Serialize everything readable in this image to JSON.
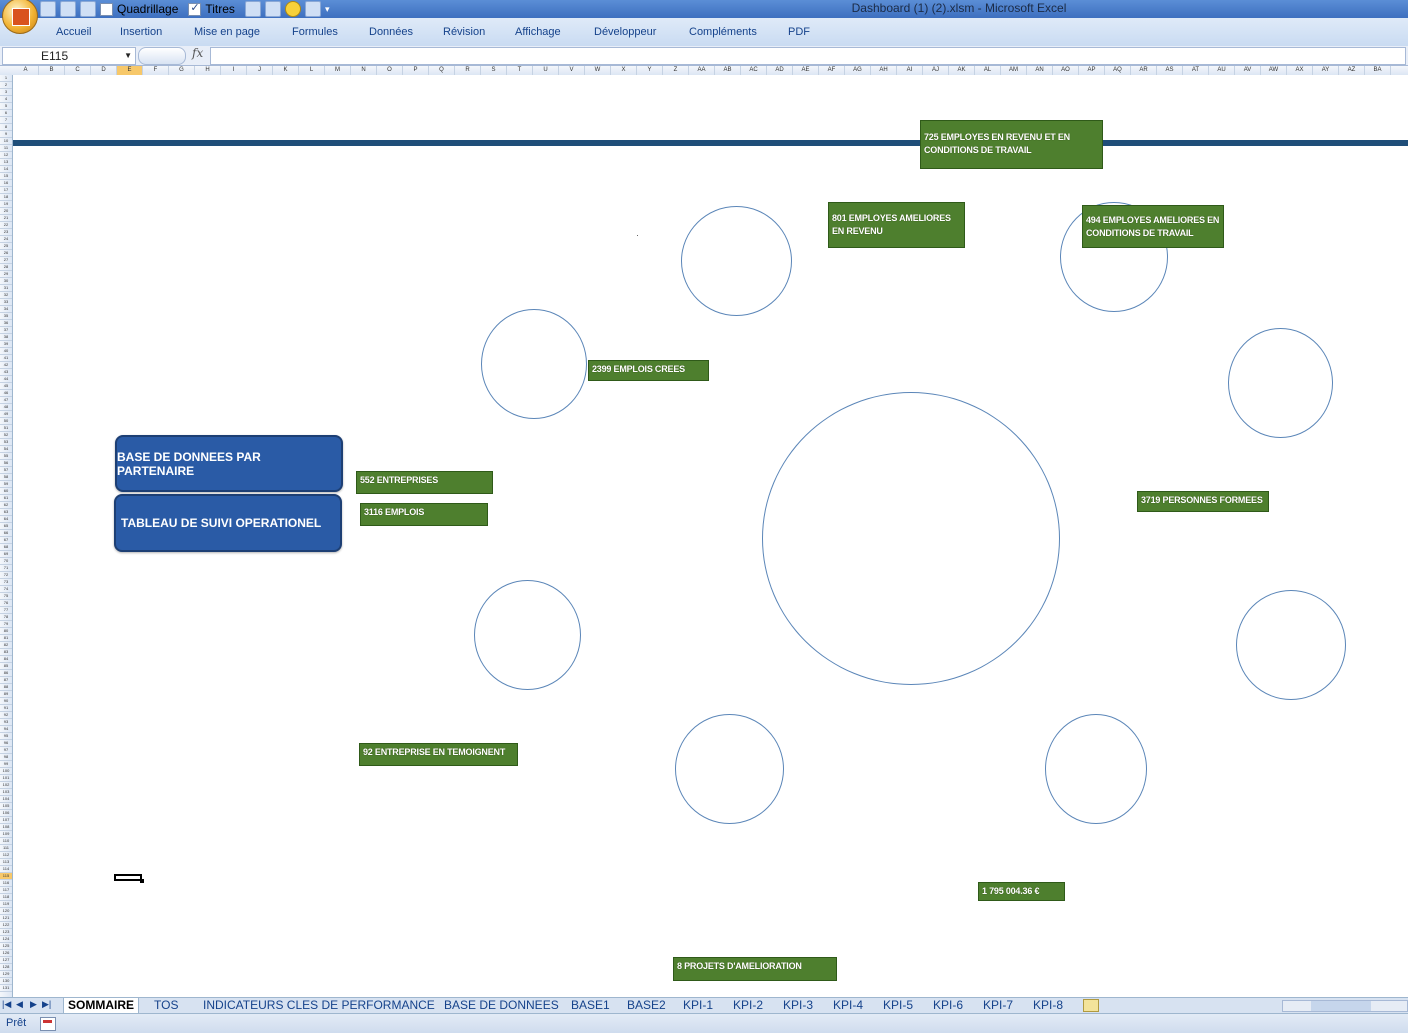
{
  "window": {
    "title": "Dashboard (1) (2).xlsm - Microsoft Excel"
  },
  "quick_access": {
    "gridlines_label": "Quadrillage",
    "gridlines_checked": false,
    "headings_label": "Titres",
    "headings_checked": true
  },
  "ribbon": {
    "tabs": [
      "Accueil",
      "Insertion",
      "Mise en page",
      "Formules",
      "Données",
      "Révision",
      "Affichage",
      "Développeur",
      "Compléments",
      "PDF"
    ]
  },
  "formula_bar": {
    "name_box": "E115",
    "fx": "fx",
    "formula": ""
  },
  "columns": [
    "A",
    "B",
    "C",
    "D",
    "E",
    "F",
    "G",
    "H",
    "I",
    "J",
    "K",
    "L",
    "M",
    "N",
    "O",
    "P",
    "Q",
    "R",
    "S",
    "T",
    "U",
    "V",
    "W",
    "X",
    "Y",
    "Z",
    "AA",
    "AB",
    "AC",
    "AD",
    "AE",
    "AF",
    "AG",
    "AH",
    "AI",
    "AJ",
    "AK",
    "AL",
    "AM",
    "AN",
    "AO",
    "AP",
    "AQ",
    "AR",
    "AS",
    "AT",
    "AU",
    "AV",
    "AW",
    "AX",
    "AY",
    "AZ",
    "BA"
  ],
  "active_column": "E",
  "active_row": 115,
  "row_count": 131,
  "dashboard": {
    "buttons": {
      "base_partenaire": "BASE DE DONNEES PAR PARTENAIRE",
      "tableau_suivi": "TABLEAU DE SUIVI OPERATIONEL"
    },
    "kpis": {
      "emplois_crees": "2399 EMPLOIS CREES",
      "entreprises": "552 ENTREPRISES",
      "emplois": "3116 EMPLOIS",
      "temoignent": "92 ENTREPRISE EN TEMOIGNENT",
      "projets": "8 PROJETS D'AMELIORATION",
      "montant": "1 795 004.36 €",
      "personnes_formees": "3719 PERSONNES FORMEES",
      "ameliores_conditions": "494 EMPLOYES AMELIORES EN CONDITIONS DE TRAVAIL",
      "ameliores_revenu": "801 EMPLOYES AMELIORES EN REVENU",
      "revenu_conditions": "725 EMPLOYES EN REVENU ET EN CONDITIONS DE TRAVAIL"
    }
  },
  "sheet_tabs": {
    "active": "SOMMAIRE",
    "others": [
      "TOS",
      "INDICATEURS CLES DE PERFORMANCE",
      "BASE DE DONNEES",
      "BASE1",
      "BASE2",
      "KPI-1",
      "KPI-2",
      "KPI-3",
      "KPI-4",
      "KPI-5",
      "KPI-6",
      "KPI-7",
      "KPI-8"
    ]
  },
  "status": {
    "ready": "Prêt"
  },
  "colors": {
    "banner": "#1f4e79",
    "kpi_green": "#4e7f2e",
    "button_blue": "#2a5ba6",
    "circle_outline": "#5b86b8"
  }
}
